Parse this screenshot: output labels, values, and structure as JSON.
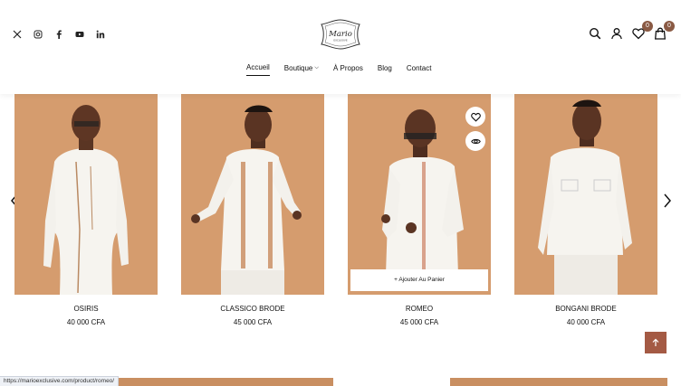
{
  "header": {
    "social_icons": [
      "x-icon",
      "instagram-icon",
      "facebook-icon",
      "youtube-icon",
      "linkedin-icon"
    ],
    "logo_text": "Mario",
    "logo_subtext": "EXCLUSIVE",
    "nav": [
      {
        "label": "Accueil",
        "active": true
      },
      {
        "label": "Boutique",
        "dropdown": true
      },
      {
        "label": "À Propos"
      },
      {
        "label": "Blog"
      },
      {
        "label": "Contact"
      }
    ],
    "wishlist_count": "0",
    "cart_count": "0"
  },
  "products": [
    {
      "name": "OSIRIS",
      "price": "40 000 CFA"
    },
    {
      "name": "CLASSICO BRODE",
      "price": "45 000 CFA"
    },
    {
      "name": "ROMEO",
      "price": "45 000 CFA",
      "hover": true,
      "add_to_cart": "+ Ajouter Au Panier"
    },
    {
      "name": "BONGANI BRODE",
      "price": "40 000 CFA"
    }
  ],
  "status_url": "https://marioexclusive.com/product/romeo/",
  "colors": {
    "photo_bg": "#d59c6e",
    "accent": "#a45a44",
    "badge": "#8a5a44"
  }
}
